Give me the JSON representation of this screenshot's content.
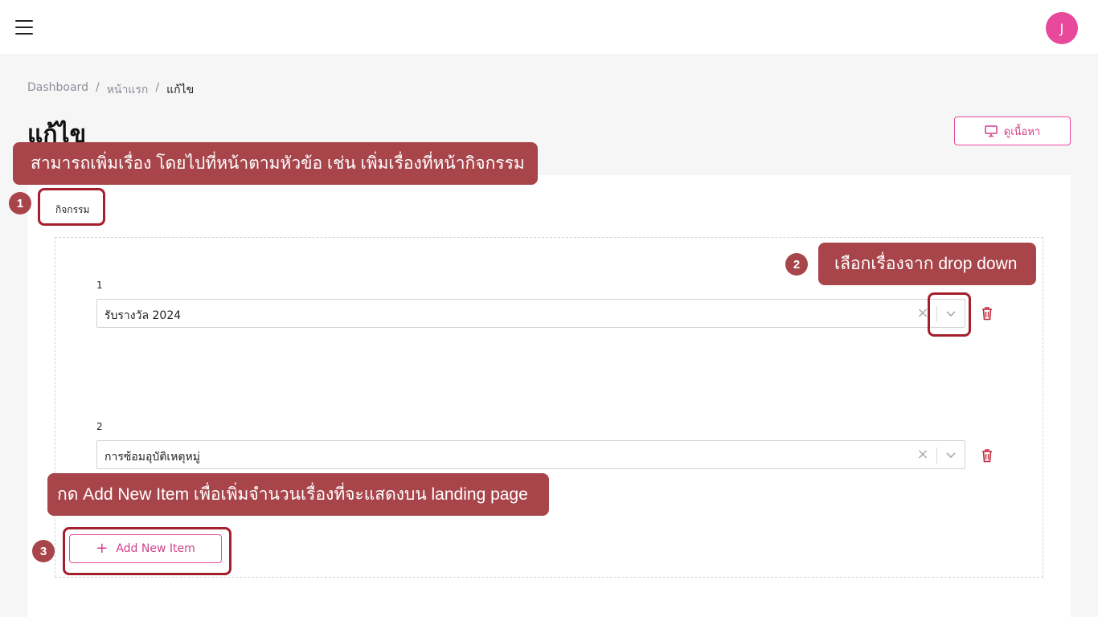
{
  "header": {
    "menu_icon": "hamburger-menu-icon",
    "avatar_initial": "J",
    "avatar_color": "#e8499a"
  },
  "breadcrumb": {
    "items": [
      "Dashboard",
      "หน้าแรก",
      "แก้ไข"
    ],
    "separator": "/"
  },
  "page": {
    "title": "แก้ไข",
    "view_button_label": "ดูเนื้อหา",
    "view_button_icon": "monitor-icon"
  },
  "section": {
    "label": "กิจกรรม",
    "items": [
      {
        "number": "1",
        "value": "รับรางวัล 2024"
      },
      {
        "number": "2",
        "value": "การซ้อมอุบัติเหตุหมู่"
      }
    ],
    "add_button_label": "Add New Item"
  },
  "annotations": {
    "callout_1": "สามารถเพิ่มเรื่อง โดยไปที่หน้าตามหัวข้อ เช่น เพิ่มเรื่องที่หน้ากิจกรรม",
    "callout_2": "เลือกเรื่องจาก drop down",
    "callout_3": "กด Add New Item เพื่อเพิ่มจำนวนเรื่องที่จะแสดงบน landing page",
    "step_badges": [
      "1",
      "2",
      "3"
    ],
    "accent_color": "#a8454b"
  },
  "colors": {
    "primary": "#e8499a",
    "delete": "#c0263a"
  }
}
